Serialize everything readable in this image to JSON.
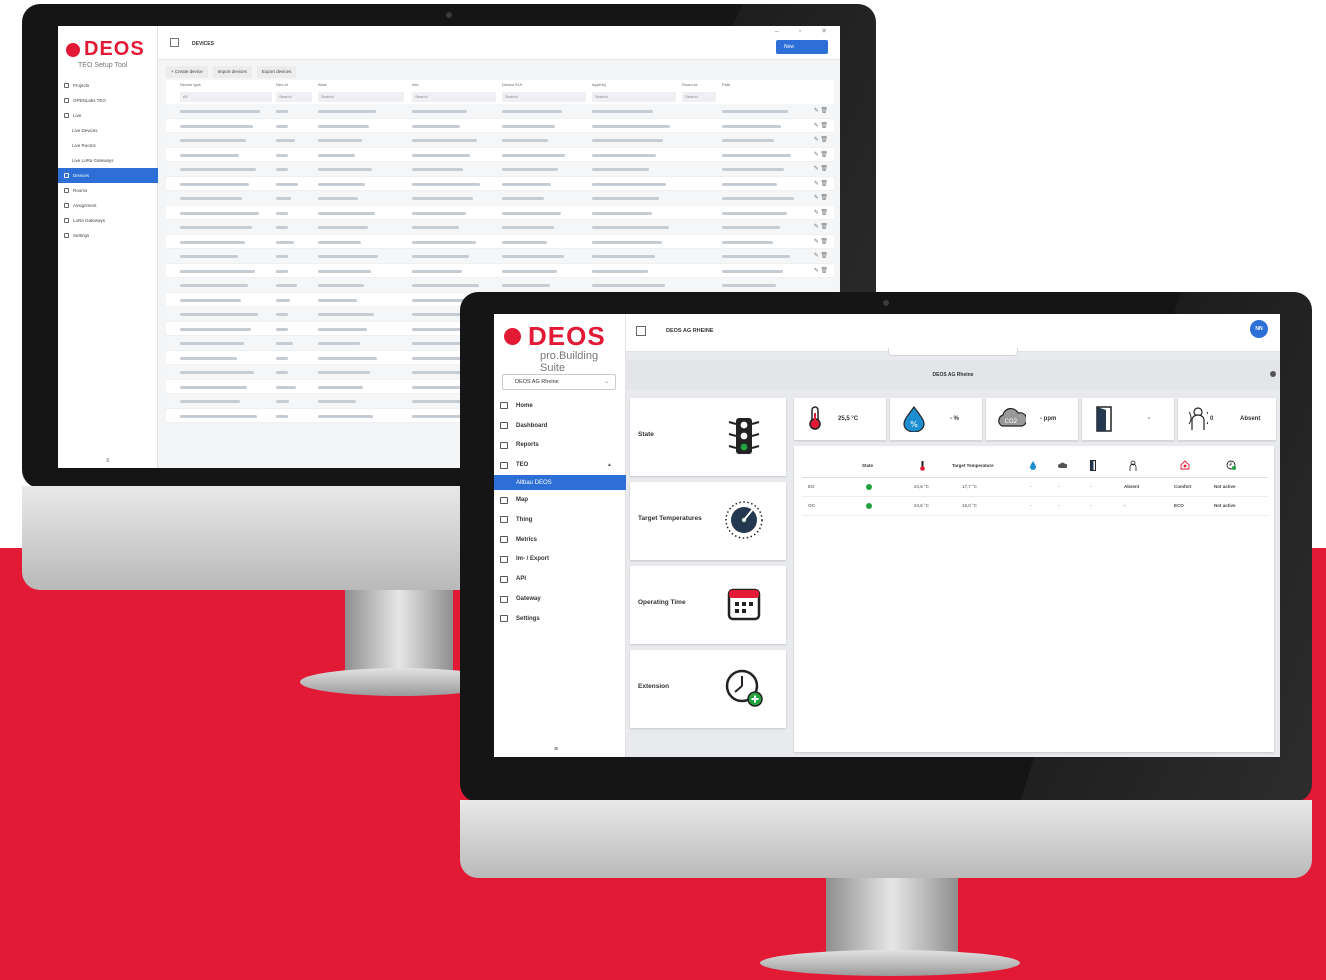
{
  "colors": {
    "brand_red": "#e21a36",
    "accent_blue": "#2d6fd6",
    "status_green": "#23a340"
  },
  "setup_tool": {
    "logo": {
      "word": "DEOS",
      "subtitle": "TEO Setup Tool"
    },
    "window_controls": "– ▫ ✕",
    "page_title": "DEVICES",
    "new_button": "New",
    "sidebar": [
      {
        "label": "Projects",
        "icon": "folder-icon"
      },
      {
        "label": "OPENLabs TEO",
        "icon": "chart-icon"
      },
      {
        "label": "Live",
        "icon": "live-icon"
      },
      {
        "label": "Live Devices",
        "sub": true
      },
      {
        "label": "Live Rooms",
        "sub": true
      },
      {
        "label": "Live LoRa Gateways",
        "sub": true
      },
      {
        "label": "Devices",
        "active": true,
        "icon": "device-icon"
      },
      {
        "label": "Rooms",
        "icon": "room-icon"
      },
      {
        "label": "Assignment",
        "icon": "link-icon"
      },
      {
        "label": "LoRa Gateways",
        "icon": "gateway-icon"
      },
      {
        "label": "Settings",
        "icon": "gear-icon"
      }
    ],
    "actions": [
      "+ Create device",
      "Import devices",
      "Export devices"
    ],
    "columns": [
      "Device type",
      "Dev-Id",
      "Alias",
      "Info",
      "Device EUI",
      "AppKey",
      "Room-Id",
      "Path"
    ],
    "filter_all": "All",
    "search_placeholder": "Search",
    "menu_icon": "≡"
  },
  "building_suite": {
    "logo": {
      "word": "DEOS",
      "subtitle": "pro.Building Suite"
    },
    "project_select": "DEOS AG Rheine",
    "page_title": "DEOS AG RHEINE",
    "avatar": "NN",
    "subheader": "DEOS AG Rheine",
    "sidebar": [
      {
        "label": "Home",
        "icon": "home-icon"
      },
      {
        "label": "Dashboard",
        "icon": "dashboard-icon"
      },
      {
        "label": "Reports",
        "icon": "reports-icon"
      },
      {
        "label": "TEO",
        "icon": "teo-icon",
        "expanded": true
      },
      {
        "label": "Altbau DEOS",
        "sub": true,
        "active": true
      },
      {
        "label": "Map",
        "icon": "map-icon"
      },
      {
        "label": "Thing",
        "icon": "thing-icon"
      },
      {
        "label": "Metrics",
        "icon": "metrics-icon"
      },
      {
        "label": "Im- / Export",
        "icon": "import-export-icon"
      },
      {
        "label": "API",
        "icon": "api-icon"
      },
      {
        "label": "Gateway",
        "icon": "gateway-icon"
      },
      {
        "label": "Settings",
        "icon": "gear-icon"
      }
    ],
    "cards": [
      {
        "label": "State",
        "icon": "traffic-light-icon"
      },
      {
        "label": "Target Temperatures",
        "icon": "gauge-icon"
      },
      {
        "label": "Operating Time",
        "icon": "calendar-icon"
      },
      {
        "label": "Extension",
        "icon": "clock-plus-icon"
      }
    ],
    "sensors": [
      {
        "icon": "thermometer-icon",
        "value": "25,5 °C"
      },
      {
        "icon": "humidity-icon",
        "value": "- %"
      },
      {
        "icon": "co2-icon",
        "value": "- ppm"
      },
      {
        "icon": "door-icon",
        "value": "-"
      },
      {
        "icon": "presence-icon",
        "value": "0",
        "status": "Absent"
      }
    ],
    "table": {
      "headers": [
        "State",
        "Target Temperature"
      ],
      "rows": [
        {
          "name": "EG",
          "temp": "24,6 °C",
          "target": "17,7 °C",
          "c1": "-",
          "c2": "-",
          "c3": "-",
          "presence": "Absent",
          "mode": "Comfort",
          "ext": "Not active"
        },
        {
          "name": "OG",
          "temp": "24,6 °C",
          "target": "16,0 °C",
          "c1": "-",
          "c2": "-",
          "c3": "-",
          "presence": "-",
          "mode": "ECO",
          "ext": "Not active"
        }
      ]
    },
    "menu_icon": "≡"
  }
}
